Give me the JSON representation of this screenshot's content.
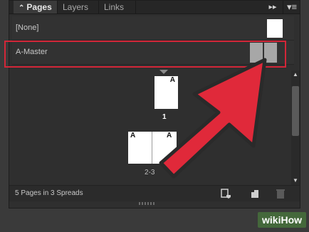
{
  "tabs": {
    "pages": "Pages",
    "pages_toggle": "⌃",
    "layers": "Layers",
    "links": "Links"
  },
  "panel_buttons": {
    "collapse_glyph": "▸▸",
    "menu_glyph": "▾≡"
  },
  "masters": [
    {
      "label": "[None]"
    },
    {
      "label": "A-Master",
      "highlighted": true
    }
  ],
  "pages": [
    {
      "prefix": "A",
      "number": "1",
      "selected": true
    },
    {
      "prefix": "A",
      "number": "2"
    },
    {
      "prefix": "A",
      "number": "3"
    }
  ],
  "spread_labels": {
    "first": "1",
    "second": "2-3"
  },
  "footer": {
    "status": "5 Pages in 3 Spreads"
  },
  "icons": {
    "new_page": "new-page-icon",
    "create_page_from_master": "page-size-icon",
    "delete": "trash-icon",
    "scroll_up": "▲",
    "scroll_down": "▼"
  },
  "colors": {
    "highlight": "#d32638",
    "arrow": "#e0293a",
    "watermark_bg": "#466e3c"
  },
  "watermark": "wikiHow"
}
